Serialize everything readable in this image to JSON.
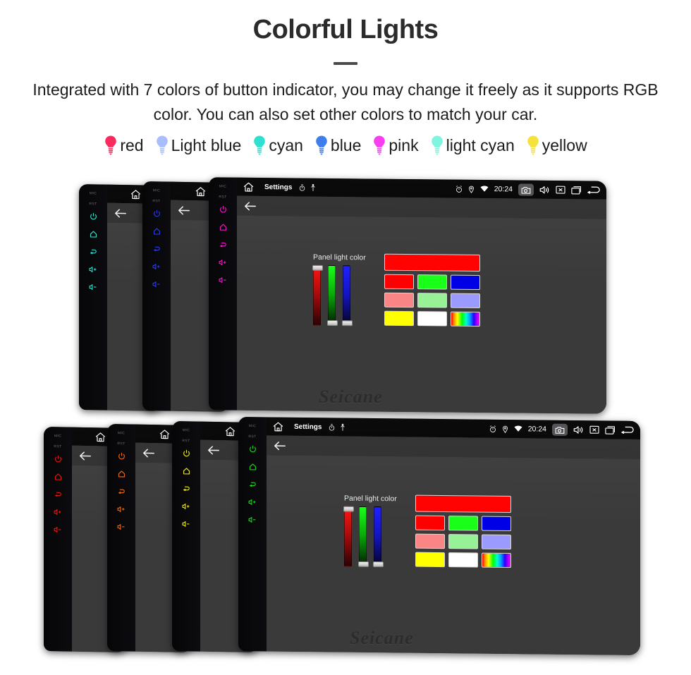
{
  "header": {
    "title": "Colorful Lights",
    "subtitle": "Integrated with 7 colors of button indicator, you may change it freely as it supports RGB color. You can also set other colors to match your car."
  },
  "legend": {
    "items": [
      {
        "label": "red",
        "color": "#fa2a5e"
      },
      {
        "label": "Light blue",
        "color": "#a9beff"
      },
      {
        "label": "cyan",
        "color": "#2ee0d0"
      },
      {
        "label": "blue",
        "color": "#3d7eeb"
      },
      {
        "label": "pink",
        "color": "#f93df0"
      },
      {
        "label": "light cyan",
        "color": "#7ff5dd"
      },
      {
        "label": "yellow",
        "color": "#f5e23c"
      }
    ]
  },
  "device_ui": {
    "status_bar": {
      "title": "Settings",
      "clock": "20:24",
      "left_icons": [
        "home-icon",
        "stopwatch-icon",
        "usb-icon"
      ],
      "right_icons": [
        "alarm-icon",
        "location-icon",
        "wifi-icon",
        "camera-icon",
        "volume-icon",
        "close-icon",
        "recents-icon",
        "back-icon"
      ]
    },
    "action_bar": {
      "back_label": "back-arrow-icon"
    },
    "panel": {
      "label": "Panel light color",
      "sliders": [
        {
          "channel": "red",
          "value": 255,
          "thumb": "top"
        },
        {
          "channel": "green",
          "value": 0,
          "thumb": "bottom"
        },
        {
          "channel": "blue",
          "value": 0,
          "thumb": "bottom"
        }
      ],
      "preview_color": "#ff0000",
      "swatch_rows": [
        [
          "#ff0000",
          "#1aff1a",
          "#0000e6"
        ],
        [
          "#fa8585",
          "#97f297",
          "#9a9aff"
        ],
        [
          "#ffff00",
          "#ffffff",
          "rainbow"
        ]
      ]
    },
    "watermark": "Seicane"
  },
  "groups": {
    "top": {
      "devices": [
        {
          "led_color": "#2ee0d0",
          "name": "cyan-device"
        },
        {
          "led_color": "#2b3ce8",
          "name": "blue-device"
        },
        {
          "led_color": "#f218c8",
          "name": "pink-device"
        }
      ]
    },
    "bottom": {
      "devices": [
        {
          "led_color": "#ee1111",
          "name": "red-device"
        },
        {
          "led_color": "#f06a10",
          "name": "orange-device"
        },
        {
          "led_color": "#ece81b",
          "name": "yellow-device"
        },
        {
          "led_color": "#1ed41e",
          "name": "green-device"
        }
      ]
    }
  },
  "side_buttons": {
    "mic_label": "MIC",
    "rst_label": "RST",
    "icons": [
      "power-icon",
      "home-icon",
      "back-icon",
      "volume-up-icon",
      "volume-down-icon"
    ]
  }
}
